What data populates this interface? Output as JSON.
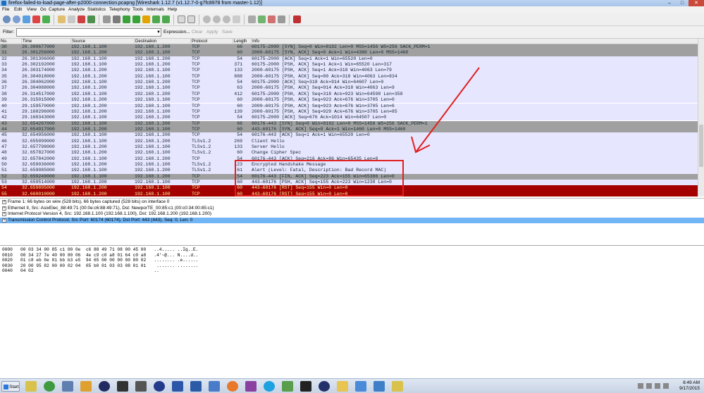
{
  "window": {
    "title": "firefox-failed-to-load-page-after-p2000-connection.pcapng  [Wireshark 1.12.7  (v1.12.7-0-g7fc8978 from master-1.12)]",
    "min": "–",
    "max": "□",
    "close": "✕"
  },
  "menu": [
    "File",
    "Edit",
    "View",
    "Go",
    "Capture",
    "Analyze",
    "Statistics",
    "Telephony",
    "Tools",
    "Internals",
    "Help"
  ],
  "filter": {
    "label": "Filter:",
    "value": "",
    "expression": "Expression...",
    "clear": "Clear",
    "apply": "Apply",
    "save": "Save"
  },
  "columns": [
    "No.",
    "Time",
    "Source",
    "Destination",
    "Protocol",
    "Length",
    "Info"
  ],
  "packets": [
    {
      "no": "30",
      "time": "26.300677000",
      "src": "192.168.1.100",
      "dst": "192.168.1.200",
      "proto": "TCP",
      "len": "66",
      "info": "60175→2000 [SYN] Seq=0 Win=8192 Len=0 MSS=1456 WS=256 SACK_PERM=1",
      "cls": "syn"
    },
    {
      "no": "31",
      "time": "26.301256000",
      "src": "192.168.1.200",
      "dst": "192.168.1.100",
      "proto": "TCP",
      "len": "60",
      "info": "2000→60175 [SYN, ACK] Seq=0 Ack=1 Win=4380 Len=0 MSS=1460",
      "cls": "syn"
    },
    {
      "no": "32",
      "time": "26.301306000",
      "src": "192.168.1.100",
      "dst": "192.168.1.200",
      "proto": "TCP",
      "len": "54",
      "info": "60175→2000 [ACK] Seq=1 Ack=1 Win=65520 Len=0",
      "cls": "tcp"
    },
    {
      "no": "33",
      "time": "26.302192000",
      "src": "192.168.1.100",
      "dst": "192.168.1.200",
      "proto": "TCP",
      "len": "371",
      "info": "60175→2000 [PSH, ACK] Seq=1 Ack=1 Win=65520 Len=317",
      "cls": "tcp"
    },
    {
      "no": "34",
      "time": "26.303174000",
      "src": "192.168.1.200",
      "dst": "192.168.1.100",
      "proto": "TCP",
      "len": "133",
      "info": "2000→60175 [PSH, ACK] Seq=1 Ack=318 Win=4063 Len=79",
      "cls": "tcp"
    },
    {
      "no": "35",
      "time": "26.304018000",
      "src": "192.168.1.200",
      "dst": "192.168.1.100",
      "proto": "TCP",
      "len": "888",
      "info": "2000→60175 [PSH, ACK] Seq=80 Ack=318 Win=4063 Len=834",
      "cls": "tcp"
    },
    {
      "no": "36",
      "time": "26.304062000",
      "src": "192.168.1.100",
      "dst": "192.168.1.200",
      "proto": "TCP",
      "len": "54",
      "info": "60175→2000 [ACK] Seq=318 Ack=914 Win=64607 Len=0",
      "cls": "tcp"
    },
    {
      "no": "37",
      "time": "26.304088000",
      "src": "192.168.1.200",
      "dst": "192.168.1.100",
      "proto": "TCP",
      "len": "63",
      "info": "2000→60175 [PSH, ACK] Seq=914 Ack=318 Win=4063 Len=9",
      "cls": "tcp"
    },
    {
      "no": "38",
      "time": "26.314517000",
      "src": "192.168.1.100",
      "dst": "192.168.1.200",
      "proto": "TCP",
      "len": "412",
      "info": "60175→2000 [PSH, ACK] Seq=318 Ack=923 Win=64598 Len=358",
      "cls": "tcp"
    },
    {
      "no": "39",
      "time": "26.315015000",
      "src": "192.168.1.200",
      "dst": "192.168.1.100",
      "proto": "TCP",
      "len": "60",
      "info": "2000→60175 [PSH, ACK] Seq=923 Ack=676 Win=3705 Len=0",
      "cls": "tcp"
    },
    {
      "no": "40",
      "time": "29.159570000",
      "src": "192.168.1.200",
      "dst": "192.168.1.100",
      "proto": "TCP",
      "len": "60",
      "info": "2000→60175 [PSH, ACK] Seq=923 Ack=676 Win=3705 Len=6",
      "cls": "tcp"
    },
    {
      "no": "41",
      "time": "29.160296000",
      "src": "192.168.1.200",
      "dst": "192.168.1.100",
      "proto": "TCP",
      "len": "139",
      "info": "2000→60175 [PSH, ACK] Seq=929 Ack=676 Win=3705 Len=85",
      "cls": "tcp"
    },
    {
      "no": "42",
      "time": "29.160343000",
      "src": "192.168.1.100",
      "dst": "192.168.1.200",
      "proto": "TCP",
      "len": "54",
      "info": "60175→2000 [ACK] Seq=676 Ack=1014 Win=64507 Len=0",
      "cls": "tcp"
    },
    {
      "no": "43",
      "time": "32.654297000",
      "src": "192.168.1.100",
      "dst": "192.168.1.200",
      "proto": "TCP",
      "len": "66",
      "info": "60176→443 [SYN] Seq=0 Win=8192 Len=0 MSS=1456 WS=256 SACK_PERM=1",
      "cls": "syn"
    },
    {
      "no": "44",
      "time": "32.654917000",
      "src": "192.168.1.200",
      "dst": "192.168.1.100",
      "proto": "TCP",
      "len": "60",
      "info": "443→60176 [SYN, ACK] Seq=0 Ack=1 Win=1460 Len=0 MSS=1460",
      "cls": "syn"
    },
    {
      "no": "45",
      "time": "32.654956000",
      "src": "192.168.1.100",
      "dst": "192.168.1.200",
      "proto": "TCP",
      "len": "54",
      "info": "60176→443 [ACK] Seq=1 Ack=1 Win=65520 Len=0",
      "cls": "tcp"
    },
    {
      "no": "46",
      "time": "32.655099000",
      "src": "192.168.1.100",
      "dst": "192.168.1.200",
      "proto": "TLSv1.2",
      "len": "269",
      "info": "Client Hello",
      "cls": "tls"
    },
    {
      "no": "47",
      "time": "32.657798000",
      "src": "192.168.1.200",
      "dst": "192.168.1.100",
      "proto": "TLSv1.2",
      "len": "133",
      "info": "Server Hello",
      "cls": "tls"
    },
    {
      "no": "48",
      "time": "32.657827000",
      "src": "192.168.1.200",
      "dst": "192.168.1.100",
      "proto": "TLSv1.2",
      "len": "60",
      "info": "Change Cipher Spec",
      "cls": "tls"
    },
    {
      "no": "49",
      "time": "32.657842000",
      "src": "192.168.1.100",
      "dst": "192.168.1.200",
      "proto": "TCP",
      "len": "54",
      "info": "60176→443 [ACK] Seq=216 Ack=86 Win=65435 Len=0",
      "cls": "tcp"
    },
    {
      "no": "50",
      "time": "32.659036000",
      "src": "192.168.1.200",
      "dst": "192.168.1.100",
      "proto": "TLSv1.2",
      "len": "123",
      "info": "Encrypted Handshake Message",
      "cls": "tls"
    },
    {
      "no": "51",
      "time": "32.659085000",
      "src": "192.168.1.100",
      "dst": "192.168.1.200",
      "proto": "TLSv1.2",
      "len": "61",
      "info": "Alert (Level: Fatal, Description: Bad Record MAC)",
      "cls": "tls"
    },
    {
      "no": "52",
      "time": "32.659249000",
      "src": "192.168.1.100",
      "dst": "192.168.1.200",
      "proto": "TCP",
      "len": "54",
      "info": "60176→443 [FIN, ACK] Seq=223 Ack=155 Win=65366 Len=0",
      "cls": "finack"
    },
    {
      "no": "53",
      "time": "32.659514000",
      "src": "192.168.1.200",
      "dst": "192.168.1.100",
      "proto": "TCP",
      "len": "60",
      "info": "443→60176 [PSH, ACK] Seq=155 Ack=223 Win=1238 Len=0",
      "cls": "tcp"
    },
    {
      "no": "54",
      "time": "32.659895000",
      "src": "192.168.1.200",
      "dst": "192.168.1.100",
      "proto": "TCP",
      "len": "60",
      "info": "443→60176 [RST] Seq=155 Win=0 Len=0",
      "cls": "rst"
    },
    {
      "no": "55",
      "time": "32.660010000",
      "src": "192.168.1.200",
      "dst": "192.168.1.100",
      "proto": "TCP",
      "len": "60",
      "info": "443→60176 [RST] Seq=155 Win=0 Len=0",
      "cls": "rst"
    }
  ],
  "details": [
    {
      "text": "Frame 1: 66 bytes on wire (528 bits), 66 bytes captured (528 bits) on interface 0",
      "sel": false
    },
    {
      "text": "Ethernet II, Src: AsixElec_88:49:71 (00:0e:c6:88:49:71), Dst: NewporTE_00:85:c1 (00:c0:34:00:85:c1)",
      "sel": false
    },
    {
      "text": "Internet Protocol Version 4, Src: 192.168.1.100 (192.168.1.100), Dst: 192.168.1.200 (192.168.1.200)",
      "sel": false
    },
    {
      "text": "Transmission Control Protocol, Src Port: 60174 (60174), Dst Port: 443 (443), Seq: 0, Len: 0",
      "sel": true
    }
  ],
  "hex": [
    "0000   00 03 34 00 85 c1 00 0e  c6 88 49 71 08 00 45 00   ..4..... ..Iq..E.",
    "0010   00 34 27 7e 40 00 80 06  4e c9 c0 a8 01 64 c0 a8   .4'~@... N....d..",
    "0020   01 c8 eb 0e 01 bb b3 e5  94 65 00 00 00 00 80 02   ........ .e......",
    "0030   20 00 95 82 00 00 02 04  05 b0 01 03 03 08 01 01    ....... ........",
    "0040   04 02                                              .."
  ],
  "taskbar": {
    "start": "Start",
    "time": "8:49 AM",
    "date": "9/17/2015"
  },
  "colors": {
    "rst_bg": "#a40000",
    "rst_fg": "#fffc9c",
    "tcp_bg": "#e7e6ff",
    "syn_bg": "#a0a0a0",
    "selected": "#72b5f4",
    "annotation": "#e12020"
  }
}
